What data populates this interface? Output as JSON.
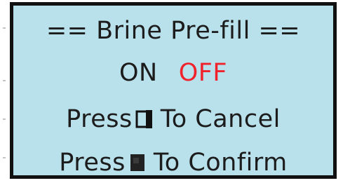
{
  "screen": {
    "title": "== Brine Pre-fill ==",
    "options": [
      {
        "label": "ON",
        "color": "#1c1c1c",
        "selected": false
      },
      {
        "label": "OFF",
        "color": "#f0222b",
        "selected": true
      }
    ],
    "cancel": {
      "prefix": "Press",
      "key_icon": "outline-square-key-icon",
      "suffix": "To Cancel"
    },
    "confirm": {
      "prefix": "Press",
      "key_icon": "filled-square-key-icon",
      "suffix": "To Confirm"
    }
  },
  "colors": {
    "screen_background": "#b9e1ec",
    "border": "#111111",
    "text": "#1c1c1c",
    "highlight": "#f0222b"
  }
}
